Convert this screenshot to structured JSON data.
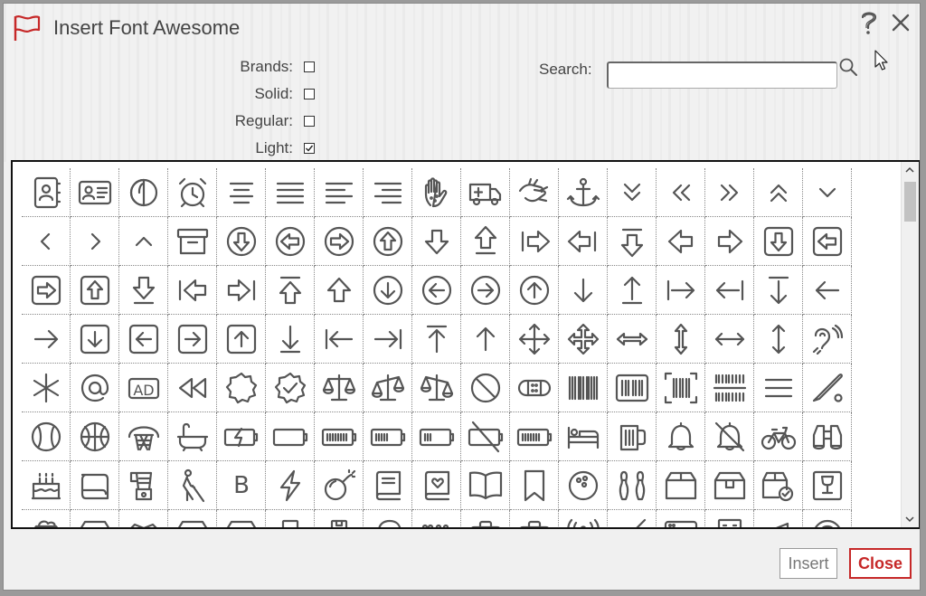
{
  "window": {
    "title": "Insert Font Awesome",
    "accent_color": "#c62828"
  },
  "options": [
    {
      "label": "Brands:",
      "checked": false
    },
    {
      "label": "Solid:",
      "checked": false
    },
    {
      "label": "Regular:",
      "checked": false
    },
    {
      "label": "Light:",
      "checked": true
    }
  ],
  "search": {
    "label": "Search:",
    "value": ""
  },
  "footer": {
    "insert_label": "Insert",
    "close_label": "Close"
  },
  "icons": [
    [
      "address-book",
      "address-card",
      "adjust",
      "alarm-clock",
      "align-center",
      "align-justify",
      "align-left",
      "align-right",
      "allergies",
      "ambulance",
      "american-sign-language-interpreting",
      "anchor",
      "angle-double-down",
      "angle-double-left",
      "angle-double-right",
      "angle-double-up",
      "angle-down"
    ],
    [
      "angle-left",
      "angle-right",
      "angle-up",
      "archive",
      "arrow-alt-circle-down",
      "arrow-alt-circle-left",
      "arrow-alt-circle-right",
      "arrow-alt-circle-up",
      "arrow-alt-down",
      "arrow-alt-from-bottom",
      "arrow-alt-from-left",
      "arrow-alt-from-right",
      "arrow-alt-from-top",
      "arrow-alt-left",
      "arrow-alt-right",
      "arrow-alt-square-down",
      "arrow-alt-square-left"
    ],
    [
      "arrow-alt-square-right",
      "arrow-alt-square-up",
      "arrow-alt-to-bottom",
      "arrow-alt-to-left",
      "arrow-alt-to-right",
      "arrow-alt-to-top",
      "arrow-alt-up",
      "arrow-circle-down",
      "arrow-circle-left",
      "arrow-circle-right",
      "arrow-circle-up",
      "arrow-down",
      "arrow-from-bottom",
      "arrow-from-left",
      "arrow-from-right",
      "arrow-from-top",
      "arrow-left"
    ],
    [
      "arrow-right",
      "arrow-square-down",
      "arrow-square-left",
      "arrow-square-right",
      "arrow-square-up",
      "arrow-to-bottom",
      "arrow-to-left",
      "arrow-to-right",
      "arrow-to-top",
      "arrow-up",
      "arrows",
      "arrows-alt",
      "arrows-alt-h",
      "arrows-alt-v",
      "arrows-h",
      "arrows-v",
      "assistive-listening-systems"
    ],
    [
      "asterisk",
      "at",
      "audio-description",
      "backward",
      "badge",
      "badge-check",
      "balance-scale",
      "balance-scale-left",
      "balance-scale-right",
      "ban",
      "band-aid",
      "barcode",
      "barcode-alt",
      "barcode-read",
      "barcode-scan",
      "bars",
      "baseball"
    ],
    [
      "baseball-ball",
      "basketball-ball",
      "basketball-hoop",
      "bath",
      "battery-bolt",
      "battery-empty",
      "battery-full",
      "battery-half",
      "battery-quarter",
      "battery-slash",
      "battery-three-quarters",
      "bed",
      "beer",
      "bell",
      "bell-slash",
      "bicycle",
      "binoculars"
    ],
    [
      "birthday-cake",
      "blanket",
      "blender",
      "blind",
      "bold",
      "bolt",
      "bomb",
      "book",
      "book-heart",
      "book-open",
      "bookmark",
      "bowling-ball",
      "bowling-pins",
      "box",
      "box-alt",
      "box-check",
      "box-fragile"
    ],
    [
      "box-full",
      "box-heart",
      "box-open",
      "box-up",
      "box-usd",
      "boxes",
      "boxes-alt",
      "boxing-glove",
      "braille",
      "briefcase",
      "briefcase-medical",
      "broadcast-tower",
      "broom",
      "browser",
      "building",
      "bullhorn",
      "bullseye"
    ]
  ]
}
